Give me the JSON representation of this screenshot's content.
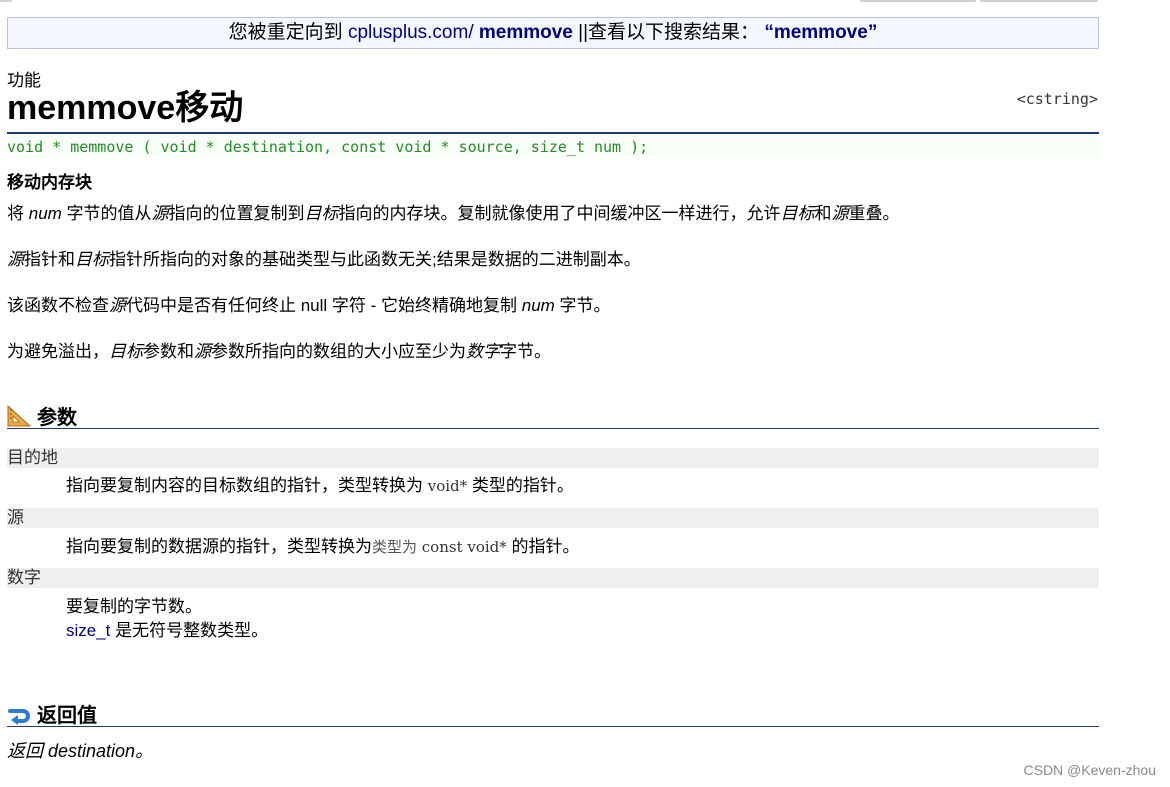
{
  "redirect": {
    "prefix": "您被重定向到 ",
    "link": "cplusplus.com/",
    "link_bold": " memmove",
    "middle": " ||查看以下搜索结果： ",
    "query": "“memmove”"
  },
  "page": {
    "kicker": "功能",
    "title": "memmove移动",
    "header_lib": "<cstring>",
    "prototype": "void * memmove ( void * destination, const void * source, size_t num );",
    "summary": "移动内存块"
  },
  "description": {
    "p1": {
      "a": "将 ",
      "b": "num",
      "c": " 字节的值从",
      "d": "源",
      "e": "指向的位置复制到",
      "f": "目标",
      "g": "指向的内存块。复制就像使用了中间缓冲区一样进行，允许",
      "h": "目标",
      "i": "和",
      "j": "源",
      "k": "重叠。"
    },
    "p2": {
      "a": "源",
      "b": "指针和",
      "c": "目标",
      "d": "指针所指向的对象的基础类型与此函数无关;结果是数据的二进制副本。"
    },
    "p3": {
      "a": "该函数不检查",
      "b": "源",
      "c": "代码中是否有任何终止 null 字符 - 它始终精确地复制 ",
      "d": "num",
      "e": " 字节。"
    },
    "p4": {
      "a": "为避免溢出，",
      "b": "目标",
      "c": "参数和",
      "d": "源",
      "e": "参数所指向的数组的大小应至少为",
      "f": "数字",
      "g": "字节。"
    }
  },
  "params_section": {
    "heading": "参数",
    "icon": "set-square-icon",
    "items": [
      {
        "name": "目的地",
        "desc_a": "指向要复制内容的目标数组的指针，类型转换为 ",
        "desc_code": "void*",
        "desc_b": " 类型的指针。"
      },
      {
        "name": "源",
        "desc_a": "指向要复制的数据源的指针，类型转换为",
        "desc_grey": "类型为",
        "desc_code": " const void*",
        "desc_b": " 的指针。"
      },
      {
        "name": "数字",
        "desc_a": "要复制的字节数。",
        "desc_type": "size_t",
        "desc_b": " 是无符号整数类型。"
      }
    ]
  },
  "return_section": {
    "heading": "返回值",
    "icon": "return-arrow-icon",
    "text": "返回 destination。"
  },
  "watermark": "CSDN @Keven-zhou",
  "colors": {
    "accent": "#000080",
    "rule": "#1f3a7a",
    "prototype": "#2a8a2a",
    "band": "#efefef"
  }
}
